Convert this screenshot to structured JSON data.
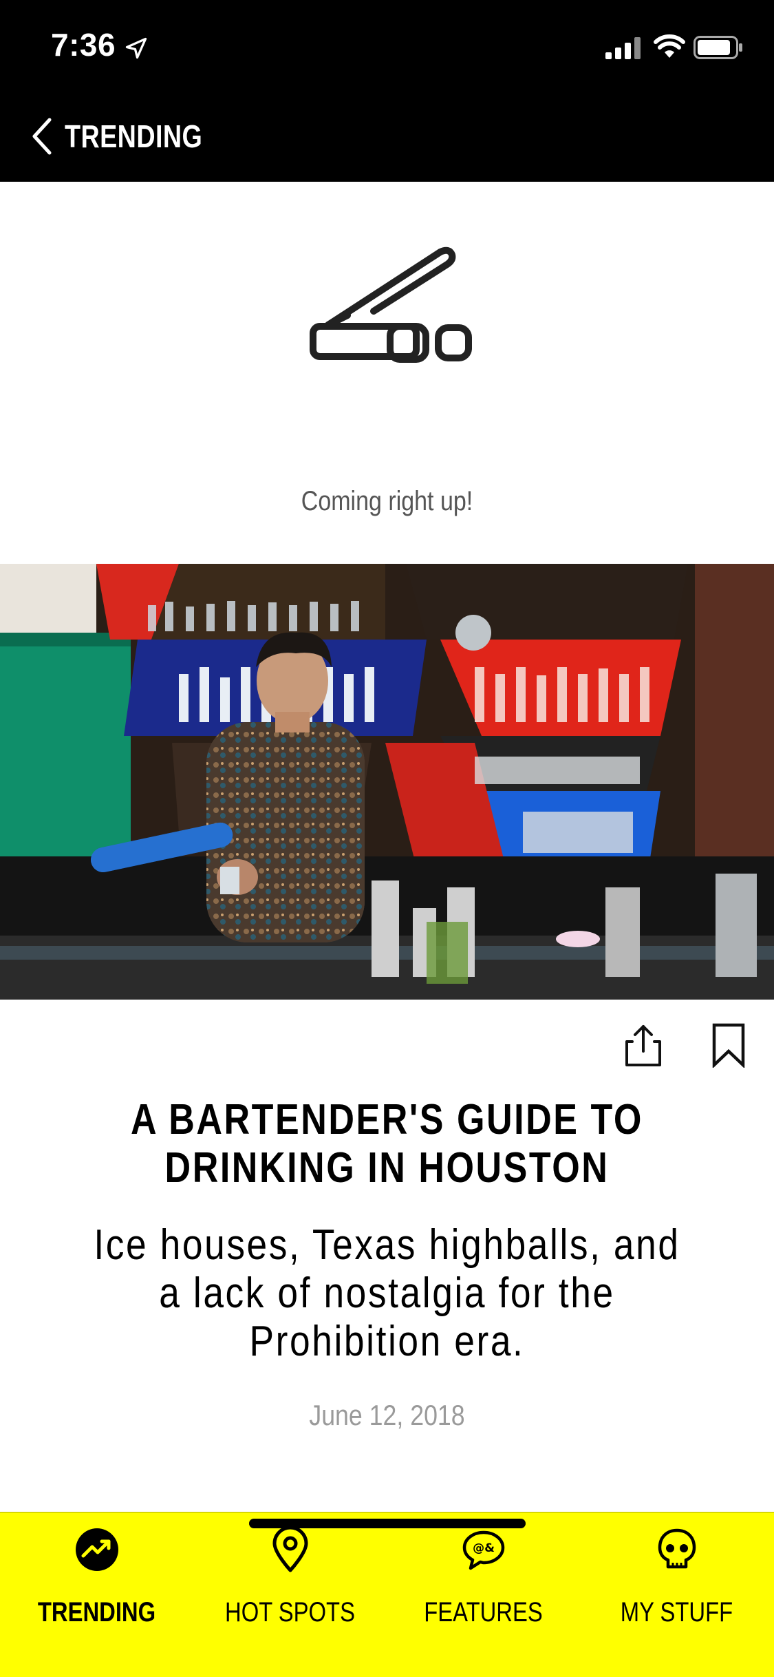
{
  "status_bar": {
    "time": "7:36"
  },
  "nav": {
    "back_title": "TRENDING"
  },
  "loading": {
    "text": "Coming right up!"
  },
  "article": {
    "title": "A BARTENDER'S GUIDE TO DRINKING IN HOUSTON",
    "subtitle": "Ice houses, Texas highballs, and a lack of nostalgia for the Prohibition era.",
    "date": "June 12, 2018"
  },
  "tabs": [
    {
      "label": "TRENDING",
      "icon": "trending-icon",
      "active": true
    },
    {
      "label": "HOT SPOTS",
      "icon": "map-pin-icon",
      "active": false
    },
    {
      "label": "FEATURES",
      "icon": "speech-bubble-icon",
      "active": false
    },
    {
      "label": "MY STUFF",
      "icon": "skull-icon",
      "active": false
    }
  ],
  "colors": {
    "tab_bar": "#ffff00",
    "nav_bar": "#000000",
    "date": "#9a9a9a"
  }
}
